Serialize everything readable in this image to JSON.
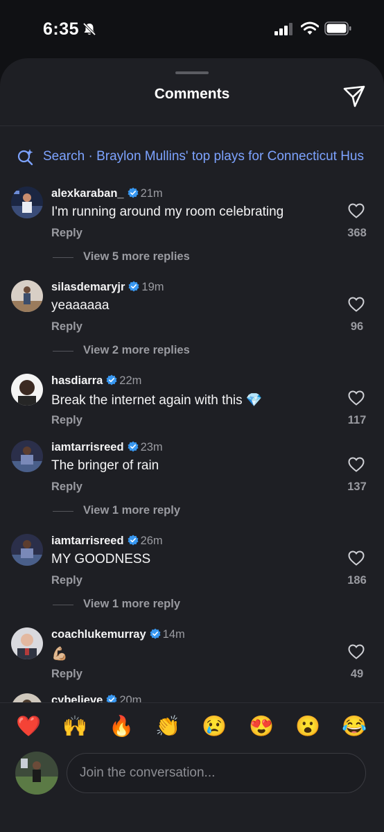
{
  "status_bar": {
    "time": "6:35"
  },
  "header": {
    "title": "Comments"
  },
  "search": {
    "label": "Search · Braylon Mullins' top plays for Connecticut Hus"
  },
  "comments": [
    {
      "username": "alexkaraban_",
      "time": "21m",
      "text": "I'm running around my room celebrating",
      "reply_label": "Reply",
      "likes": "368",
      "more_replies": "View 5 more replies"
    },
    {
      "username": "silasdemaryjr",
      "time": "19m",
      "text": "yeaaaaaa",
      "reply_label": "Reply",
      "likes": "96",
      "more_replies": "View 2 more replies"
    },
    {
      "username": "hasdiarra",
      "time": "22m",
      "text": "Break the internet again with this 💎",
      "reply_label": "Reply",
      "likes": "117"
    },
    {
      "username": "iamtarrisreed",
      "time": "23m",
      "text": "The bringer of rain",
      "reply_label": "Reply",
      "likes": "137",
      "more_replies": "View 1 more reply"
    },
    {
      "username": "iamtarrisreed",
      "time": "26m",
      "text": "MY GOODNESS",
      "reply_label": "Reply",
      "likes": "186",
      "more_replies": "View 1 more reply"
    },
    {
      "username": "coachlukemurray",
      "time": "14m",
      "text": "💪🏼",
      "reply_label": "Reply",
      "likes": "49"
    },
    {
      "username": "cybelieve",
      "time": "20m"
    }
  ],
  "reactions": [
    "❤️",
    "🙌",
    "🔥",
    "👏",
    "😢",
    "😍",
    "😮",
    "😂"
  ],
  "composer": {
    "placeholder": "Join the conversation..."
  },
  "colors": {
    "background": "#101114",
    "sheet": "#1e1f24",
    "link": "#7da3ff",
    "verified": "#3897f0",
    "muted": "#9a9ba1"
  },
  "icons": [
    "bell-slash-icon",
    "cellular-signal-icon",
    "wifi-icon",
    "battery-icon",
    "send-icon",
    "search-sparkle-icon",
    "verified-badge-icon",
    "heart-icon"
  ]
}
